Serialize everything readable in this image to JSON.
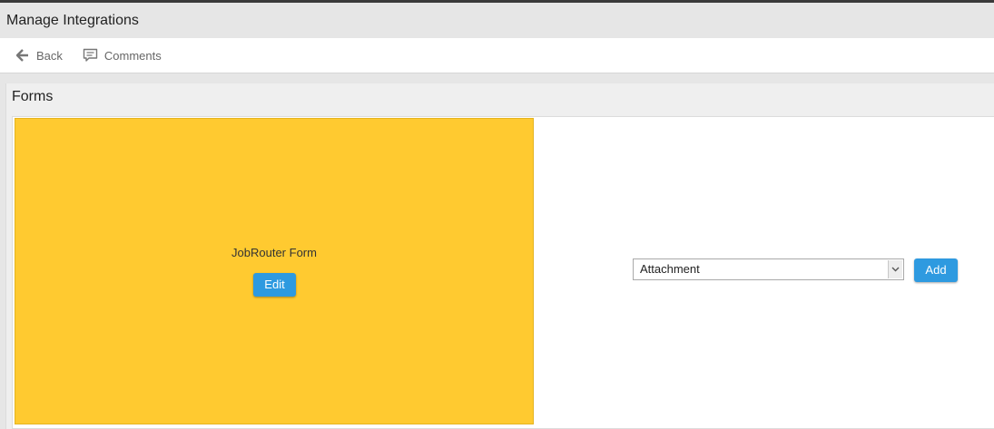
{
  "header": {
    "title": "Manage Integrations"
  },
  "toolbar": {
    "back_label": "Back",
    "back_icon": "arrow-left-icon",
    "comments_label": "Comments",
    "comments_icon": "comment-icon"
  },
  "panel": {
    "title": "Forms",
    "form_tile": {
      "name": "JobRouter Form",
      "edit_label": "Edit",
      "color": "#ffca30"
    },
    "add_row": {
      "selected": "Attachment",
      "add_label": "Add"
    }
  },
  "colors": {
    "accent": "#2e9ae0",
    "tile": "#ffca30"
  }
}
